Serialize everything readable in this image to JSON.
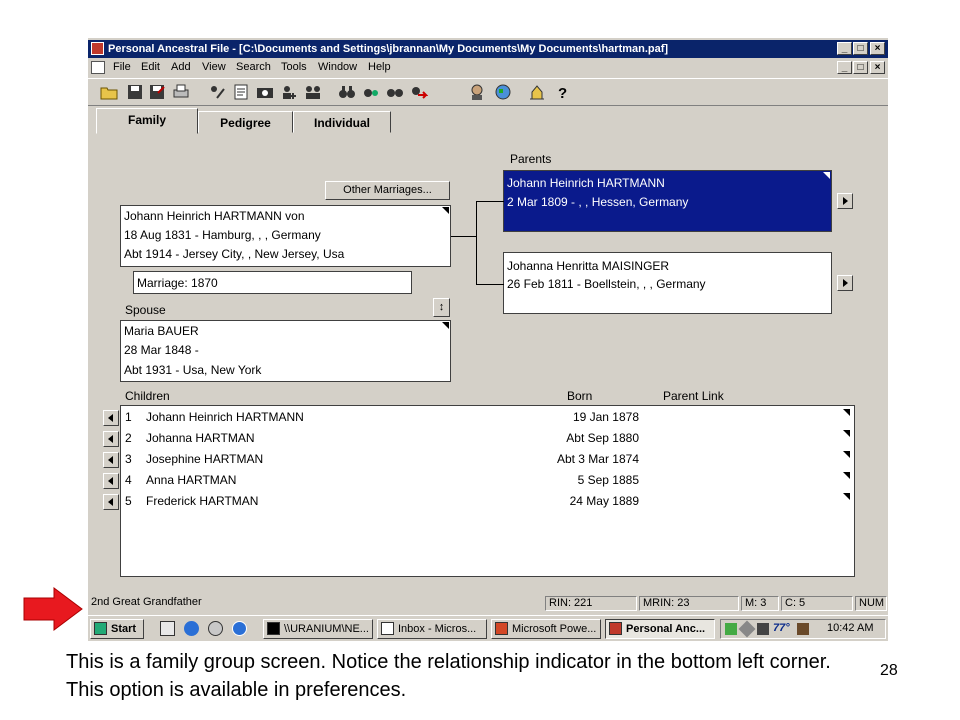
{
  "window": {
    "title": "Personal Ancestral File - [C:\\Documents and Settings\\jbrannan\\My Documents\\My Documents\\hartman.paf]",
    "caption_buttons": [
      "_",
      "□",
      "×"
    ]
  },
  "menu": [
    "File",
    "Edit",
    "Add",
    "View",
    "Search",
    "Tools",
    "Window",
    "Help"
  ],
  "tabs": [
    "Family",
    "Pedigree",
    "Individual"
  ],
  "individual": {
    "name": "Johann Heinrich HARTMANN von",
    "birth": "18 Aug 1831 - Hamburg, , , Germany",
    "death": "Abt 1914 - Jersey City, , New Jersey, Usa"
  },
  "other_marriages_label": "Other Marriages...",
  "marriage": "Marriage: 1870",
  "spouse": {
    "label": "Spouse",
    "name": "Maria BAUER",
    "birth": "28 Mar 1848 -",
    "death": "Abt 1931 - Usa, New York"
  },
  "parents": {
    "label": "Parents",
    "father": {
      "name": "Johann Heinrich HARTMANN",
      "birth": "2 Mar 1809 - , , Hessen, Germany"
    },
    "mother": {
      "name": "Johanna Henritta MAISINGER",
      "birth": "26 Feb 1811 - Boellstein, , , Germany"
    }
  },
  "children": {
    "label": "Children",
    "born_header": "Born",
    "parent_link_header": "Parent Link",
    "rows": [
      {
        "num": "1",
        "name": "Johann Heinrich HARTMANN",
        "born": "19 Jan 1878"
      },
      {
        "num": "2",
        "name": "Johanna HARTMAN",
        "born": "Abt Sep 1880"
      },
      {
        "num": "3",
        "name": "Josephine HARTMAN",
        "born": "Abt 3 Mar 1874"
      },
      {
        "num": "4",
        "name": "Anna HARTMAN",
        "born": "5 Sep 1885"
      },
      {
        "num": "5",
        "name": "Frederick HARTMAN",
        "born": "24 May 1889"
      }
    ]
  },
  "status": {
    "relationship": "2nd Great Grandfather",
    "rin": "RIN: 221",
    "mrin": "MRIN: 23",
    "m": "M: 3",
    "c": "C: 5",
    "num": "NUM"
  },
  "taskbar": {
    "start": "Start",
    "buttons": [
      "\\\\URANIUM\\NE...",
      "Inbox - Micros...",
      "Microsoft Powe...",
      "Personal Anc..."
    ],
    "temp": "77°",
    "clock": "10:42 AM"
  },
  "caption": "This is a family group screen.  Notice the relationship indicator in the bottom left corner.  This option is available in preferences.",
  "slide_number": "28",
  "colors": {
    "title_bar": "#0a246a",
    "selected_parent": "#0a1a8c",
    "arrow": "#e8191f"
  }
}
